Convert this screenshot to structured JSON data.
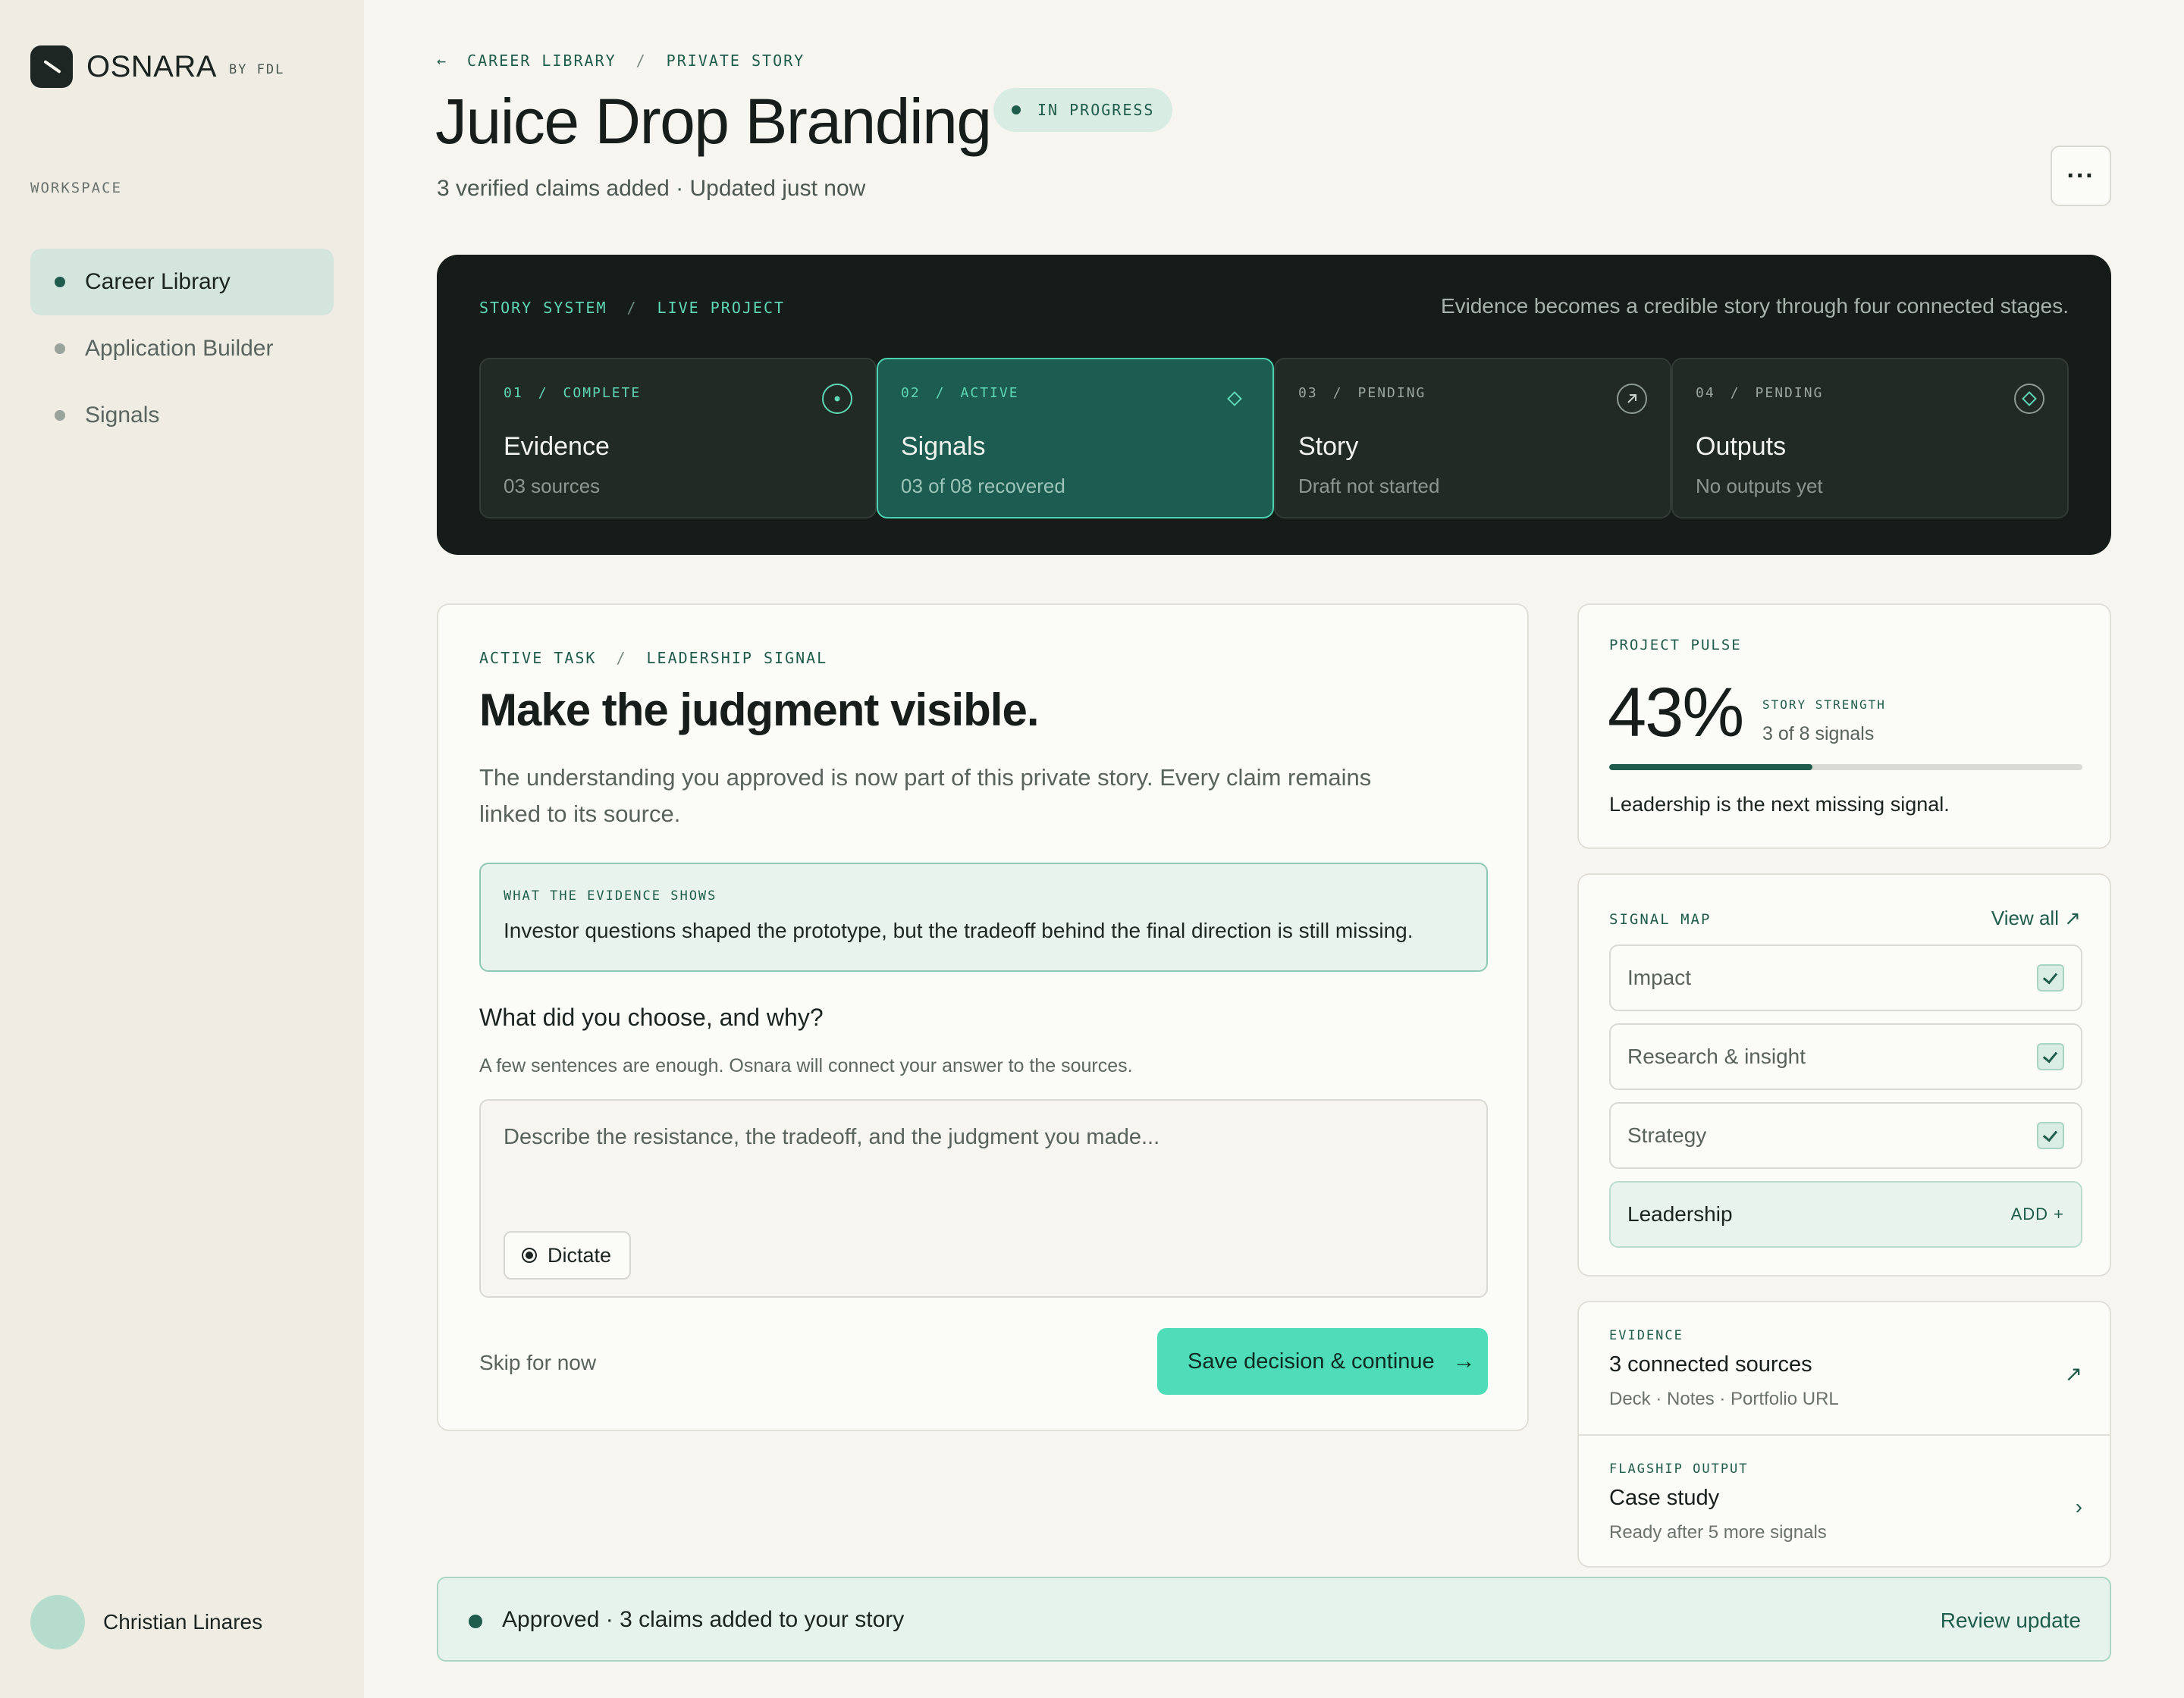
{
  "brand": {
    "name": "OSNARA",
    "by": "BY FDL"
  },
  "sidebar": {
    "section_label": "WORKSPACE",
    "items": [
      {
        "label": "Career Library",
        "active": true
      },
      {
        "label": "Application Builder",
        "active": false
      },
      {
        "label": "Signals",
        "active": false
      }
    ],
    "user": {
      "name": "Christian Linares"
    }
  },
  "header": {
    "breadcrumb": {
      "back": "←",
      "parent": "CAREER LIBRARY",
      "sep": "/",
      "current": "PRIVATE STORY"
    },
    "title": "Juice Drop Branding",
    "status": "IN PROGRESS",
    "subtitle": "3 verified claims added · Updated just now",
    "more_label": "···"
  },
  "story_system": {
    "crumb": {
      "a": "STORY SYSTEM",
      "sep": "/",
      "b": "LIVE PROJECT"
    },
    "description": "Evidence becomes a credible story through four connected stages.",
    "stages": [
      {
        "num": "01",
        "sep": "/",
        "state": "COMPLETE",
        "name": "Evidence",
        "note": "03 sources",
        "icon": "target-icon"
      },
      {
        "num": "02",
        "sep": "/",
        "state": "ACTIVE",
        "name": "Signals",
        "note": "03 of 08 recovered",
        "icon": "diamond-icon"
      },
      {
        "num": "03",
        "sep": "/",
        "state": "PENDING",
        "name": "Story",
        "note": "Draft not started",
        "icon": "arrow-up-right-icon"
      },
      {
        "num": "04",
        "sep": "/",
        "state": "PENDING",
        "name": "Outputs",
        "note": "No outputs yet",
        "icon": "diamond-icon"
      }
    ]
  },
  "task": {
    "crumb": {
      "a": "ACTIVE TASK",
      "sep": "/",
      "b": "LEADERSHIP SIGNAL"
    },
    "title": "Make the judgment visible.",
    "lead": "The understanding you approved is now part of this private story. Every claim remains linked to its source.",
    "evidence_label": "WHAT THE EVIDENCE SHOWS",
    "evidence_text": "Investor questions shaped the prototype, but the tradeoff behind the final direction is still missing.",
    "question": "What did you choose, and why?",
    "hint": "A few sentences are enough. Osnara will connect your answer to the sources.",
    "placeholder": "Describe the resistance, the tradeoff, and the judgment you made...",
    "dictate_label": "Dictate",
    "skip_label": "Skip for now",
    "primary_label": "Save decision & continue",
    "primary_arrow": "→"
  },
  "pulse": {
    "label": "PROJECT PULSE",
    "percent_text": "43%",
    "progress": 0.43,
    "strength_label": "STORY STRENGTH",
    "signals_text": "3 of 8 signals",
    "note": "Leadership is the next missing signal."
  },
  "signal_map": {
    "label": "SIGNAL MAP",
    "view_all": "View all ↗",
    "items": [
      {
        "label": "Impact",
        "done": true
      },
      {
        "label": "Research & insight",
        "done": true
      },
      {
        "label": "Strategy",
        "done": true
      },
      {
        "label": "Leadership",
        "done": false,
        "action": "ADD +"
      }
    ]
  },
  "evidence_card": {
    "label": "EVIDENCE",
    "title": "3 connected sources",
    "sub": "Deck · Notes · Portfolio URL",
    "icon": "↗"
  },
  "output_card": {
    "label": "FLAGSHIP OUTPUT",
    "title": "Case study",
    "sub": "Ready after 5 more signals",
    "icon": "›"
  },
  "toast": {
    "text": "Approved · 3 claims added to your story",
    "link": "Review update"
  },
  "colors": {
    "accent": "#4fdcb8",
    "brand_green": "#1f5c4b",
    "system_bg": "#161c19"
  }
}
